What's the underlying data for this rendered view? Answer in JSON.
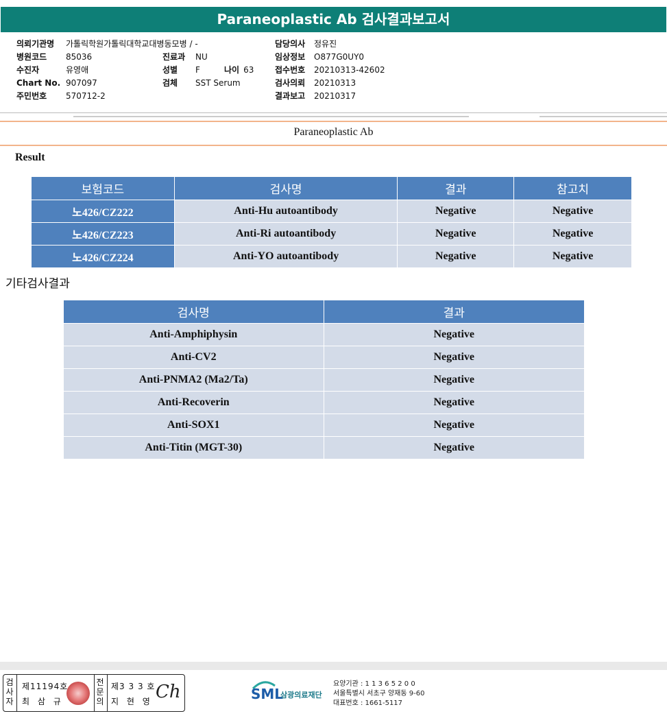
{
  "header": {
    "title": "Paraneoplastic Ab 검사결과보고서"
  },
  "info_left": [
    {
      "label": "의뢰기관명",
      "value": "가톨릭학원가톨릭대학교대병동모병 / -"
    },
    {
      "label": "병원코드",
      "value": "85036"
    },
    {
      "label": "수진자",
      "value": "유영애"
    },
    {
      "label": "Chart No.",
      "value": "907097"
    },
    {
      "label": "주민번호",
      "value": "570712-2"
    }
  ],
  "info_mid": {
    "dept_label": "진료과",
    "dept_value": "NU",
    "sex_label": "성별",
    "sex_value": "F",
    "age_label": "나이",
    "age_value": "63",
    "specimen_label": "검체",
    "specimen_value": "SST Serum"
  },
  "info_right": [
    {
      "label": "담당의사",
      "value": "정유진"
    },
    {
      "label": "임상정보",
      "value": "O877G0UY0"
    },
    {
      "label": "접수번호",
      "value": "20210313-42602"
    },
    {
      "label": "검사의뢰",
      "value": "20210313"
    },
    {
      "label": "결과보고",
      "value": "20210317"
    }
  ],
  "section_title": "Paraneoplastic Ab",
  "result_label": "Result",
  "result_table": {
    "headers": [
      "보험코드",
      "검사명",
      "결과",
      "참고치"
    ],
    "rows": [
      {
        "code": "노426/CZ222",
        "name": "Anti-Hu autoantibody",
        "result": "Negative",
        "ref": "Negative"
      },
      {
        "code": "노426/CZ223",
        "name": "Anti-Ri autoantibody",
        "result": "Negative",
        "ref": "Negative"
      },
      {
        "code": "노426/CZ224",
        "name": "Anti-YO autoantibody",
        "result": "Negative",
        "ref": "Negative"
      }
    ]
  },
  "other_label": "기타검사결과",
  "other_table": {
    "headers": [
      "검사명",
      "결과"
    ],
    "rows": [
      {
        "name": "Anti-Amphiphysin",
        "result": "Negative"
      },
      {
        "name": "Anti-CV2",
        "result": "Negative"
      },
      {
        "name": "Anti-PNMA2 (Ma2/Ta)",
        "result": "Negative"
      },
      {
        "name": "Anti-Recoverin",
        "result": "Negative"
      },
      {
        "name": "Anti-SOX1",
        "result": "Negative"
      },
      {
        "name": "Anti-Titin (MGT-30)",
        "result": "Negative"
      }
    ]
  },
  "footer": {
    "examiner_label": "검사자",
    "examiner_no": "제11194호",
    "examiner_name": "최 삼 규",
    "doctor_label": "전문의",
    "doctor_no": "제3 3 3 호",
    "doctor_name": "지 현 영",
    "logo_text": "SML",
    "org_name": "삼광의료재단",
    "org_code": "요양기관 : 1 1 3 6 5 2 0 0",
    "address": "서울특별시 서초구 양재동 9-60",
    "phone": "대표번호 : 1661-5117"
  },
  "colors": {
    "title_bar": "#0e7f77",
    "table_header": "#4f81bd",
    "table_cell": "#d3dbe8",
    "rule": "#f2b48a"
  }
}
